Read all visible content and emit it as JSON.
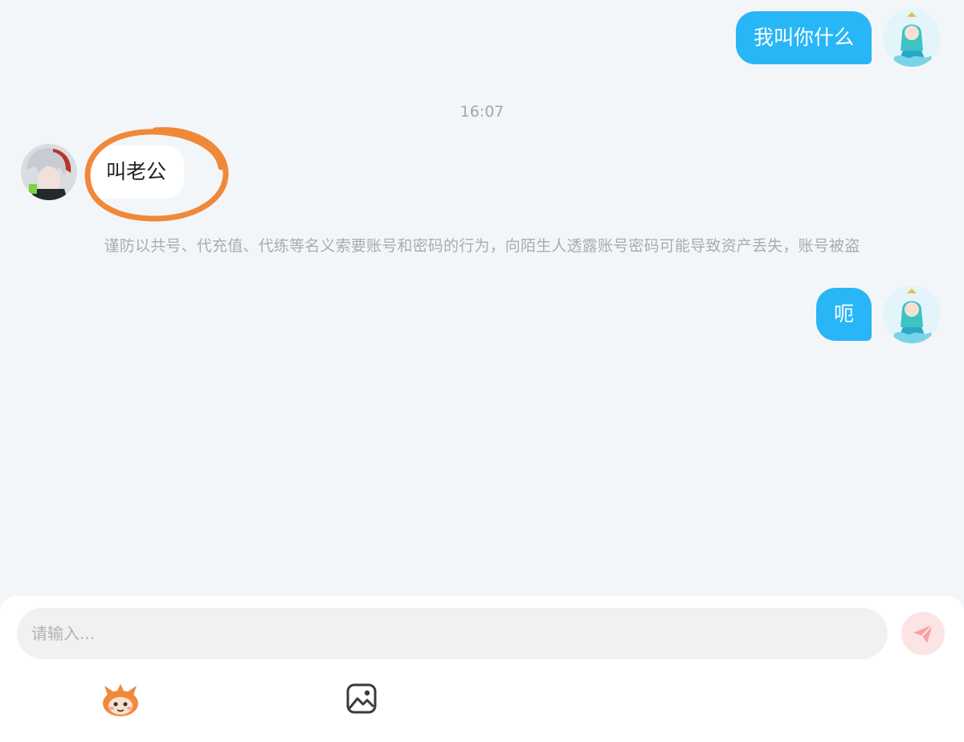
{
  "messages": [
    {
      "side": "out",
      "text": "我叫你什么"
    },
    {
      "side": "in",
      "text": "叫老公"
    },
    {
      "side": "out",
      "text": "呃"
    }
  ],
  "time_divider": "16:07",
  "safety_notice": "谨防以共号、代充值、代练等名义索要账号和密码的行为，向陌生人透露账号密码可能导致资产丢失，账号被盗",
  "composer": {
    "placeholder": "请输入...",
    "send_icon": "send-icon",
    "tools": [
      "emoji-mascot-icon",
      "image-icon"
    ]
  },
  "colors": {
    "outgoing_bubble": "#29b6f6",
    "incoming_bubble": "#ffffff",
    "highlight_circle": "#f0883a",
    "send_button_bg": "#fde4e4",
    "send_icon": "#f5a3a3",
    "background": "#f3f6f9"
  }
}
